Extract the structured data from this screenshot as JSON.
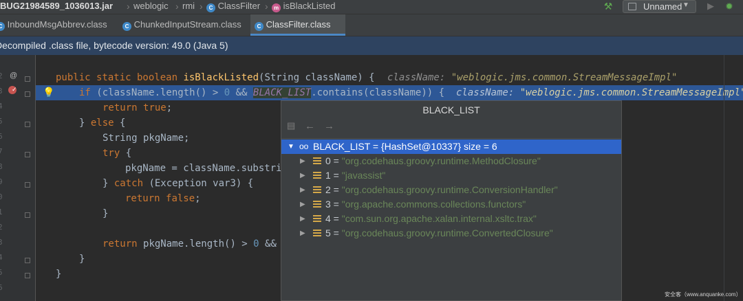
{
  "navbar": {
    "crumbs": [
      {
        "label": "BUG21984589_1036013.jar",
        "icon": "jar-icon"
      },
      {
        "label": "weblogic",
        "icon": "package-icon"
      },
      {
        "label": "rmi",
        "icon": "package-icon"
      },
      {
        "label": "ClassFilter",
        "icon": "class-icon"
      },
      {
        "label": "isBlackListed",
        "icon": "method-icon"
      }
    ],
    "run_config": "Unnamed",
    "icons": [
      "hammer-icon",
      "play-icon",
      "debug-bug-icon"
    ]
  },
  "tabs": [
    {
      "label": "InboundMsgAbbrev.class",
      "active": false
    },
    {
      "label": "ChunkedInputStream.class",
      "active": false
    },
    {
      "label": "ClassFilter.class",
      "active": true
    }
  ],
  "banner": "Decompiled .class file, bytecode version: 49.0 (Java 5)",
  "gutter": {
    "line_numbers": [
      "",
      "2",
      "3",
      "4",
      "5",
      "6",
      "7",
      "8",
      "9",
      "0",
      "1",
      "2",
      "3",
      "4",
      "5",
      "6"
    ]
  },
  "code": {
    "signature": {
      "kw": "public static boolean ",
      "name": "isBlackListed",
      "params": "(String className) {",
      "hint_label": "className: ",
      "hint_value": "\"weblogic.jms.common.StreamMessageImpl\""
    },
    "if_line": {
      "kw": "if",
      "pre": " (className.length() > ",
      "num": "0",
      "mid": " && ",
      "static": "BLACK_LIST",
      "post": ".contains(className)) {",
      "hint_label": "className: ",
      "hint_value": "\"weblogic.jms.common.StreamMessageImpl\""
    },
    "return_true": {
      "kw": "return ",
      "value": "true",
      "end": ";"
    },
    "else_line": {
      "pre": "} ",
      "kw": "else",
      "post": " {"
    },
    "string_pkg": "String pkgName;",
    "try_line": {
      "kw": "try",
      "post": " {"
    },
    "pkg_assign": "pkgName = className.substri",
    "catch_line": {
      "pre": "} ",
      "kw": "catch",
      "post": " (Exception var3) {"
    },
    "return_false": {
      "kw": "return ",
      "value": "false",
      "end": ";"
    },
    "close1": "}",
    "return_len": {
      "kw": "return ",
      "pre": "pkgName.length() > ",
      "num": "0",
      "post": " &&"
    },
    "close2": "}",
    "close3": "}"
  },
  "popup": {
    "title": "BLACK_LIST",
    "root": {
      "label": "BLACK_LIST = {HashSet@10337}  size = 6"
    },
    "items": [
      {
        "index": "0",
        "value": "\"org.codehaus.groovy.runtime.MethodClosure\""
      },
      {
        "index": "1",
        "value": "\"javassist\""
      },
      {
        "index": "2",
        "value": "\"org.codehaus.groovy.runtime.ConversionHandler\""
      },
      {
        "index": "3",
        "value": "\"org.apache.commons.collections.functors\""
      },
      {
        "index": "4",
        "value": "\"com.sun.org.apache.xalan.internal.xsltc.trax\""
      },
      {
        "index": "5",
        "value": "\"org.codehaus.groovy.runtime.ConvertedClosure\""
      }
    ]
  },
  "watermark": "安全客（www.anquanke.com）",
  "colors": {
    "selection": "#2f65ca",
    "line_highlight": "#2d5796",
    "banner": "#2e4360",
    "string": "#6a8759",
    "keyword": "#cc7832"
  }
}
